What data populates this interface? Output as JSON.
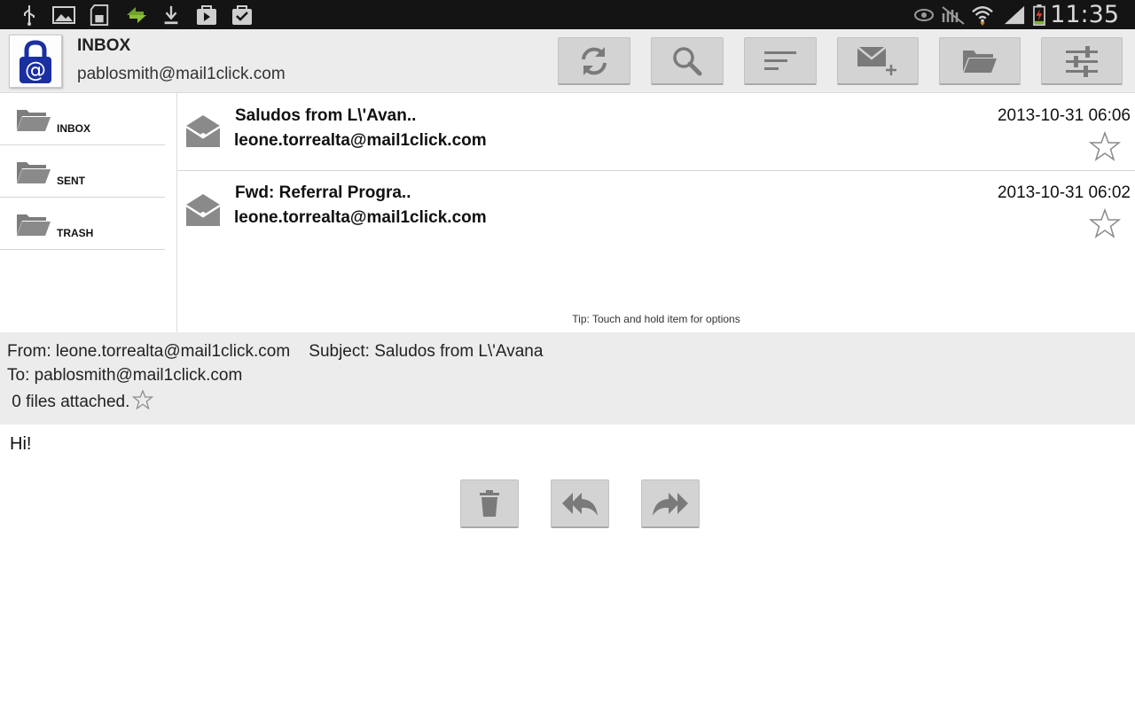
{
  "status_bar": {
    "time": "11:35",
    "left_icons": [
      "usb-icon",
      "image-icon",
      "sd-card-icon",
      "sync-arrows-icon",
      "download-icon",
      "play-store-icon",
      "checked-bag-icon"
    ],
    "right_icons": [
      "eye-icon",
      "mute-icon",
      "wifi-icon",
      "signal-icon",
      "battery-charging-icon"
    ]
  },
  "header": {
    "title": "INBOX",
    "account": "pablosmith@mail1click.com",
    "toolbar": [
      "refresh-icon",
      "search-icon",
      "sort-icon",
      "compose-icon",
      "folder-icon",
      "settings-icon"
    ]
  },
  "folders": [
    {
      "label": "INBOX"
    },
    {
      "label": "SENT"
    },
    {
      "label": "TRASH"
    }
  ],
  "messages": [
    {
      "subject": "Saludos from L\\'Avan..",
      "from": "leone.torrealta@mail1click.com",
      "date": "2013-10-31 06:06"
    },
    {
      "subject": "Fwd: Referral Progra..",
      "from": "leone.torrealta@mail1click.com",
      "date": "2013-10-31 06:02"
    }
  ],
  "tip": "Tip: Touch and hold item for options",
  "preview": {
    "from_line": "From: leone.torrealta@mail1click.com    Subject: Saludos from L\\'Avana",
    "to_line": "To: pablosmith@mail1click.com",
    "attachments": " 0 files attached.",
    "body": "Hi!"
  },
  "colors": {
    "statusbar": "#141414",
    "header_bg": "#ececec",
    "button_bg": "#d3d3d3",
    "icon_gray": "#7a7a7a",
    "logo_blue": "#1a2fa0"
  }
}
